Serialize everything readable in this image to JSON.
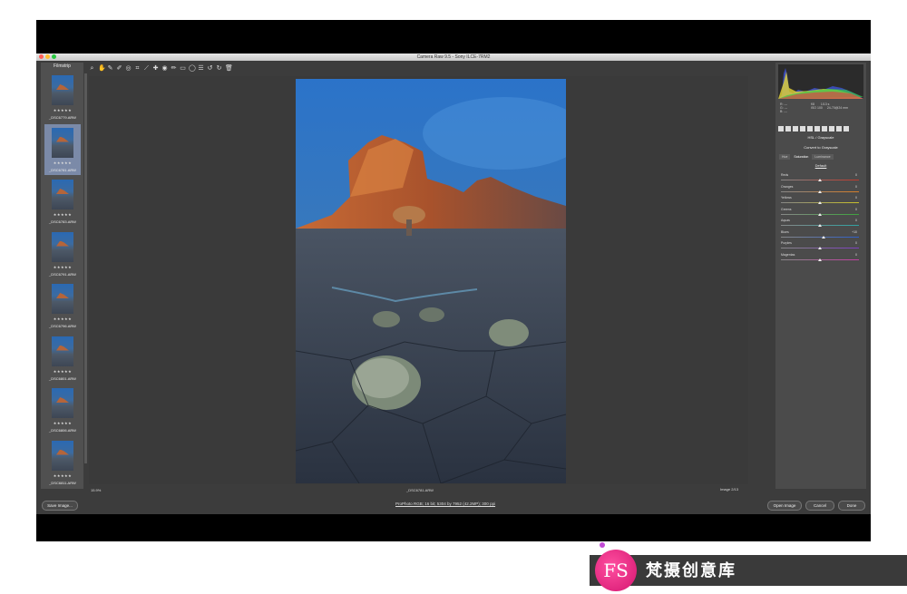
{
  "window": {
    "title": "Camera Raw 9.5 - Sony ILCE-7RM2"
  },
  "filmstrip": {
    "header": "Filmstrip",
    "items": [
      {
        "name": "_DSC6779.ARW",
        "stars": "★★★★★",
        "selected": false
      },
      {
        "name": "_DSC6781.ARW",
        "stars": "★★★★★",
        "selected": true
      },
      {
        "name": "_DSC6783.ARW",
        "stars": "★★★★★",
        "selected": false
      },
      {
        "name": "_DSC6791.ARW",
        "stars": "★★★★★",
        "selected": false
      },
      {
        "name": "_DSC6796.ARW",
        "stars": "★★★★★",
        "selected": false
      },
      {
        "name": "_DSC6801.ARW",
        "stars": "★★★★★",
        "selected": false
      },
      {
        "name": "_DSC6806.ARW",
        "stars": "★★★★★",
        "selected": false
      },
      {
        "name": "_DSC6811.ARW",
        "stars": "★★★★★",
        "selected": false
      }
    ]
  },
  "toolbar": {
    "icons": [
      "zoom-icon",
      "hand-icon",
      "white-balance-icon",
      "color-sampler-icon",
      "targeted-adjust-icon",
      "crop-icon",
      "straighten-icon",
      "spot-removal-icon",
      "red-eye-icon",
      "adjustment-brush-icon",
      "graduated-filter-icon",
      "radial-filter-icon",
      "preferences-icon",
      "rotate-left-icon",
      "rotate-right-icon",
      "trash-icon"
    ]
  },
  "status": {
    "zoom": "15.9%",
    "filename": "_DSC6781.ARW",
    "image_count": "Image 2/13"
  },
  "right_panel": {
    "rgb": {
      "r": "R: ---",
      "g": "G: ---",
      "b": "B: ---"
    },
    "exif": {
      "aperture": "f/8",
      "shutter": "1/13 s",
      "iso": "ISO 100",
      "lens": "24-70@24 mm"
    },
    "panel_title": "HSL / Grayscale",
    "convert_label": "Convert to Grayscale",
    "subtabs": [
      "Hue",
      "Saturation",
      "Luminance"
    ],
    "default_link": "Default",
    "sliders": [
      {
        "label": "Reds",
        "value": "0",
        "color": "#c0392b",
        "level": 0.5
      },
      {
        "label": "Oranges",
        "value": "0",
        "color": "#d67d28",
        "level": 0.5
      },
      {
        "label": "Yellows",
        "value": "0",
        "color": "#c8c02a",
        "level": 0.5
      },
      {
        "label": "Greens",
        "value": "0",
        "color": "#3ea33e",
        "level": 0.5
      },
      {
        "label": "Aquas",
        "value": "0",
        "color": "#2fa3a3",
        "level": 0.5
      },
      {
        "label": "Blues",
        "value": "+10",
        "color": "#2e5fc9",
        "level": 0.55
      },
      {
        "label": "Purples",
        "value": "0",
        "color": "#7d3fc0",
        "level": 0.5
      },
      {
        "label": "Magentas",
        "value": "0",
        "color": "#c23fa2",
        "level": 0.5
      }
    ]
  },
  "bottom": {
    "save_label": "Save Image...",
    "workflow_text": "ProPhoto RGB; 16 bit; 5304 by 7952 (42.2MP); 300 ppi",
    "open_label": "Open Image",
    "cancel_label": "Cancel",
    "done_label": "Done"
  },
  "watermark": {
    "logo_text": "FS",
    "brand": "梵摄创意库"
  }
}
